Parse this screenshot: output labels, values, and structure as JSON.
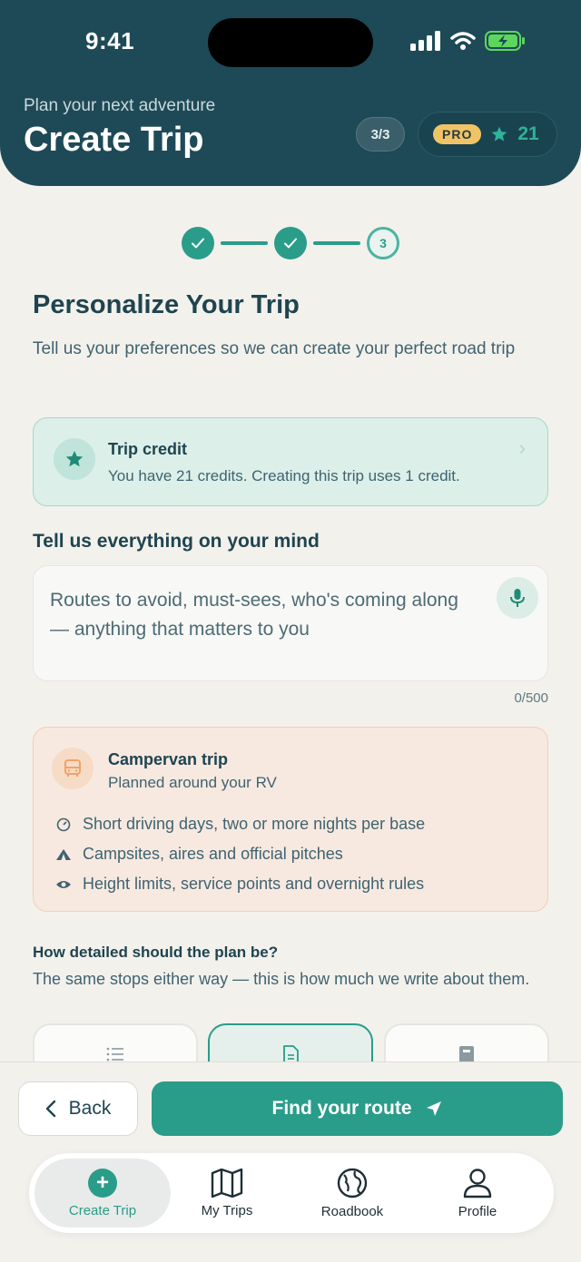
{
  "status_bar": {
    "time": "9:41"
  },
  "header": {
    "subtitle": "Plan your next adventure",
    "title": "Create Trip",
    "step_indicator": "3/3",
    "pro_label": "PRO",
    "credit_count": "21"
  },
  "stepper": {
    "current_step": "3",
    "steps": 3
  },
  "section": {
    "title": "Personalize Your Trip",
    "description": "Tell us your preferences so we can create your perfect road trip"
  },
  "credit_card": {
    "title": "Trip credit",
    "text": "You have 21 credits. Creating this trip uses 1 credit."
  },
  "mind": {
    "label": "Tell us everything on your mind",
    "placeholder": "Routes to avoid, must-sees, who's coming along — anything that matters to you",
    "char_count": "0/500"
  },
  "camper": {
    "title": "Campervan trip",
    "subtitle": "Planned around your RV",
    "features": [
      {
        "icon": "gauge-icon",
        "text": "Short driving days, two or more nights per base"
      },
      {
        "icon": "tent-icon",
        "text": "Campsites, aires and official pitches"
      },
      {
        "icon": "eye-icon",
        "text": "Height limits, service points and overnight rules"
      }
    ]
  },
  "detail": {
    "question": "How detailed should the plan be?",
    "description": "The same stops either way — this is how much we write about them.",
    "options": [
      {
        "icon": "list-icon",
        "selected": false
      },
      {
        "icon": "document-icon",
        "selected": true
      },
      {
        "icon": "book-icon",
        "selected": false
      }
    ]
  },
  "actions": {
    "back": "Back",
    "find": "Find your route"
  },
  "tabs": [
    {
      "label": "Create Trip",
      "icon": "plus-circle-icon",
      "active": true
    },
    {
      "label": "My Trips",
      "icon": "map-icon",
      "active": false
    },
    {
      "label": "Roadbook",
      "icon": "globe-icon",
      "active": false
    },
    {
      "label": "Profile",
      "icon": "person-icon",
      "active": false
    }
  ],
  "colors": {
    "primary": "#2a9c8a",
    "header": "#1e4a57",
    "pro": "#f0c466",
    "camper_accent": "#f2a266"
  }
}
